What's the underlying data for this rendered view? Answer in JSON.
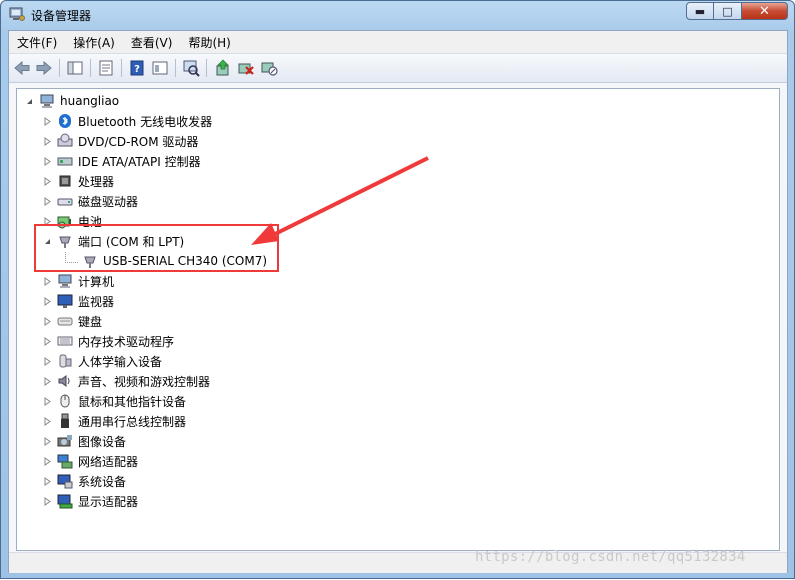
{
  "window": {
    "title": "设备管理器",
    "minimize_label": "▬",
    "maximize_label": "□",
    "close_label": "✕"
  },
  "menu": [
    "文件(F)",
    "操作(A)",
    "查看(V)",
    "帮助(H)"
  ],
  "toolbar_icons": [
    "back-icon",
    "forward-icon",
    "show-hide-tree-icon",
    "properties-icon",
    "help-icon",
    "view-icon",
    "scan-hardware-icon",
    "update-driver-icon",
    "uninstall-icon",
    "disable-icon"
  ],
  "tree": {
    "root": "huangliao",
    "items": [
      {
        "label": "Bluetooth 无线电收发器",
        "icon": "bluetooth-icon"
      },
      {
        "label": "DVD/CD-ROM 驱动器",
        "icon": "dvd-drive-icon"
      },
      {
        "label": "IDE ATA/ATAPI 控制器",
        "icon": "ide-controller-icon"
      },
      {
        "label": "处理器",
        "icon": "processor-icon"
      },
      {
        "label": "磁盘驱动器",
        "icon": "disk-drive-icon"
      },
      {
        "label": "电池",
        "icon": "battery-icon"
      },
      {
        "label": "端口 (COM 和 LPT)",
        "icon": "port-icon",
        "expanded": true,
        "children": [
          {
            "label": "USB-SERIAL CH340 (COM7)",
            "icon": "port-icon"
          }
        ]
      },
      {
        "label": "计算机",
        "icon": "computer-icon"
      },
      {
        "label": "监视器",
        "icon": "monitor-icon"
      },
      {
        "label": "键盘",
        "icon": "keyboard-icon"
      },
      {
        "label": "内存技术驱动程序",
        "icon": "memory-icon"
      },
      {
        "label": "人体学输入设备",
        "icon": "hid-icon"
      },
      {
        "label": "声音、视频和游戏控制器",
        "icon": "sound-icon"
      },
      {
        "label": "鼠标和其他指针设备",
        "icon": "mouse-icon"
      },
      {
        "label": "通用串行总线控制器",
        "icon": "usb-icon"
      },
      {
        "label": "图像设备",
        "icon": "camera-icon"
      },
      {
        "label": "网络适配器",
        "icon": "network-icon"
      },
      {
        "label": "系统设备",
        "icon": "system-device-icon"
      },
      {
        "label": "显示适配器",
        "icon": "display-adapter-icon"
      }
    ]
  },
  "watermark": "https://blog.csdn.net/qq5132834",
  "colors": {
    "highlight": "#f03a3a",
    "selection": "#3399ff"
  }
}
